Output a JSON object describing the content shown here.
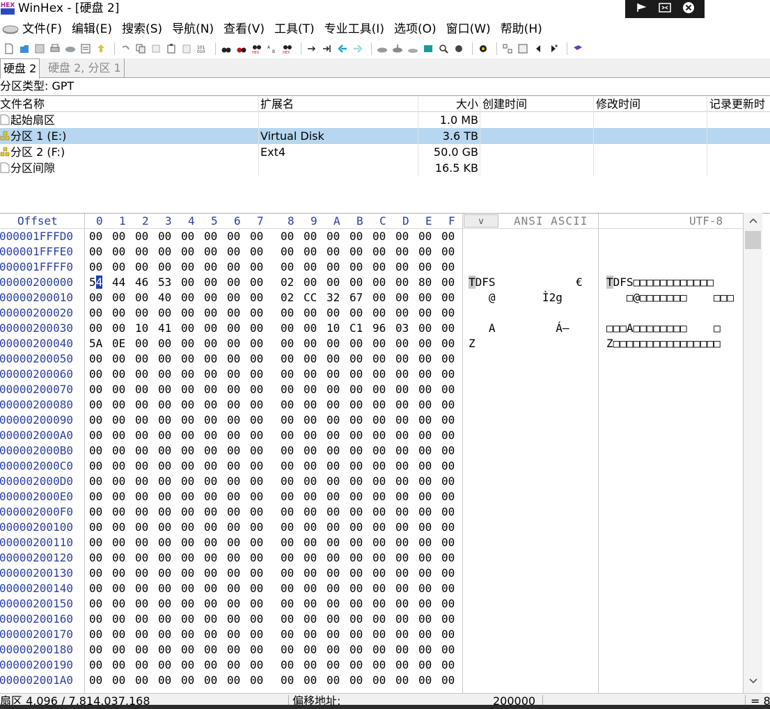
{
  "window": {
    "title": "WinHex - [硬盘 2]",
    "controls": [
      "flag-icon",
      "restore-icon",
      "close-icon"
    ]
  },
  "menu": {
    "items": [
      "文件(F)",
      "编辑(E)",
      "搜索(S)",
      "导航(N)",
      "查看(V)",
      "工具(T)",
      "专业工具(I)",
      "选项(O)",
      "窗口(W)",
      "帮助(H)"
    ]
  },
  "tabs": [
    "硬盘 2",
    "硬盘 2, 分区 1"
  ],
  "partition_type": "分区类型: GPT",
  "file_table": {
    "columns": [
      "文件名称",
      "扩展名",
      "大小",
      "创建时间",
      "修改时间",
      "记录更新时"
    ],
    "rows": [
      {
        "name": "起始扇区",
        "ext": "",
        "size": "1.0 MB",
        "icon": "file-icon",
        "selected": false
      },
      {
        "name": "分区 1 (E:)",
        "ext": "Virtual Disk",
        "size": "3.6 TB",
        "icon": "partition-icon",
        "selected": true
      },
      {
        "name": "分区 2 (F:)",
        "ext": "Ext4",
        "size": "50.0 GB",
        "icon": "partition-icon",
        "selected": false
      },
      {
        "name": "分区间隙",
        "ext": "",
        "size": "16.5 KB",
        "icon": "file-icon",
        "selected": false
      }
    ]
  },
  "hex": {
    "offset_header": "Offset",
    "column_headers": [
      "0",
      "1",
      "2",
      "3",
      "4",
      "5",
      "6",
      "7",
      "8",
      "9",
      "A",
      "B",
      "C",
      "D",
      "E",
      "F"
    ],
    "v_button": "v",
    "ansi_header": "ANSI ASCII",
    "utf8_header": "UTF-8",
    "rows": [
      {
        "offset": "000001FFFD0",
        "bytes": [
          "00",
          "00",
          "00",
          "00",
          "00",
          "00",
          "00",
          "00",
          "00",
          "00",
          "00",
          "00",
          "00",
          "00",
          "00",
          "00"
        ],
        "ansi": "",
        "utf8": ""
      },
      {
        "offset": "000001FFFE0",
        "bytes": [
          "00",
          "00",
          "00",
          "00",
          "00",
          "00",
          "00",
          "00",
          "00",
          "00",
          "00",
          "00",
          "00",
          "00",
          "00",
          "00"
        ],
        "ansi": "",
        "utf8": ""
      },
      {
        "offset": "000001FFFF0",
        "bytes": [
          "00",
          "00",
          "00",
          "00",
          "00",
          "00",
          "00",
          "00",
          "00",
          "00",
          "00",
          "00",
          "00",
          "00",
          "00",
          "00"
        ],
        "ansi": "",
        "utf8": ""
      },
      {
        "offset": "00000200000",
        "bytes": [
          "54",
          "44",
          "46",
          "53",
          "00",
          "00",
          "00",
          "00",
          "02",
          "00",
          "00",
          "00",
          "00",
          "00",
          "80",
          "00"
        ],
        "ansi": "TDFS            €",
        "utf8": "TDFS□□□□□□□□□□□□"
      },
      {
        "offset": "00000200010",
        "bytes": [
          "00",
          "00",
          "00",
          "40",
          "00",
          "00",
          "00",
          "00",
          "02",
          "CC",
          "32",
          "67",
          "00",
          "00",
          "00",
          "00"
        ],
        "ansi": "   @       Ì2g",
        "utf8": "   □@□□□□□□□    □□□"
      },
      {
        "offset": "00000200020",
        "bytes": [
          "00",
          "00",
          "00",
          "00",
          "00",
          "00",
          "00",
          "00",
          "00",
          "00",
          "00",
          "00",
          "00",
          "00",
          "00",
          "00"
        ],
        "ansi": "",
        "utf8": ""
      },
      {
        "offset": "00000200030",
        "bytes": [
          "00",
          "00",
          "10",
          "41",
          "00",
          "00",
          "00",
          "00",
          "00",
          "00",
          "10",
          "C1",
          "96",
          "03",
          "00",
          "00"
        ],
        "ansi": "   A         Á–",
        "utf8": "□□□A□□□□□□□□    □"
      },
      {
        "offset": "00000200040",
        "bytes": [
          "5A",
          "0E",
          "00",
          "00",
          "00",
          "00",
          "00",
          "00",
          "00",
          "00",
          "00",
          "00",
          "00",
          "00",
          "00",
          "00"
        ],
        "ansi": "Z",
        "utf8": "Z□□□□□□□□□□□□□□□□"
      },
      {
        "offset": "00000200050",
        "bytes": [
          "00",
          "00",
          "00",
          "00",
          "00",
          "00",
          "00",
          "00",
          "00",
          "00",
          "00",
          "00",
          "00",
          "00",
          "00",
          "00"
        ],
        "ansi": "",
        "utf8": ""
      },
      {
        "offset": "00000200060",
        "bytes": [
          "00",
          "00",
          "00",
          "00",
          "00",
          "00",
          "00",
          "00",
          "00",
          "00",
          "00",
          "00",
          "00",
          "00",
          "00",
          "00"
        ],
        "ansi": "",
        "utf8": ""
      },
      {
        "offset": "00000200070",
        "bytes": [
          "00",
          "00",
          "00",
          "00",
          "00",
          "00",
          "00",
          "00",
          "00",
          "00",
          "00",
          "00",
          "00",
          "00",
          "00",
          "00"
        ],
        "ansi": "",
        "utf8": ""
      },
      {
        "offset": "00000200080",
        "bytes": [
          "00",
          "00",
          "00",
          "00",
          "00",
          "00",
          "00",
          "00",
          "00",
          "00",
          "00",
          "00",
          "00",
          "00",
          "00",
          "00"
        ],
        "ansi": "",
        "utf8": ""
      },
      {
        "offset": "00000200090",
        "bytes": [
          "00",
          "00",
          "00",
          "00",
          "00",
          "00",
          "00",
          "00",
          "00",
          "00",
          "00",
          "00",
          "00",
          "00",
          "00",
          "00"
        ],
        "ansi": "",
        "utf8": ""
      },
      {
        "offset": "000002000A0",
        "bytes": [
          "00",
          "00",
          "00",
          "00",
          "00",
          "00",
          "00",
          "00",
          "00",
          "00",
          "00",
          "00",
          "00",
          "00",
          "00",
          "00"
        ],
        "ansi": "",
        "utf8": ""
      },
      {
        "offset": "000002000B0",
        "bytes": [
          "00",
          "00",
          "00",
          "00",
          "00",
          "00",
          "00",
          "00",
          "00",
          "00",
          "00",
          "00",
          "00",
          "00",
          "00",
          "00"
        ],
        "ansi": "",
        "utf8": ""
      },
      {
        "offset": "000002000C0",
        "bytes": [
          "00",
          "00",
          "00",
          "00",
          "00",
          "00",
          "00",
          "00",
          "00",
          "00",
          "00",
          "00",
          "00",
          "00",
          "00",
          "00"
        ],
        "ansi": "",
        "utf8": ""
      },
      {
        "offset": "000002000D0",
        "bytes": [
          "00",
          "00",
          "00",
          "00",
          "00",
          "00",
          "00",
          "00",
          "00",
          "00",
          "00",
          "00",
          "00",
          "00",
          "00",
          "00"
        ],
        "ansi": "",
        "utf8": ""
      },
      {
        "offset": "000002000E0",
        "bytes": [
          "00",
          "00",
          "00",
          "00",
          "00",
          "00",
          "00",
          "00",
          "00",
          "00",
          "00",
          "00",
          "00",
          "00",
          "00",
          "00"
        ],
        "ansi": "",
        "utf8": ""
      },
      {
        "offset": "000002000F0",
        "bytes": [
          "00",
          "00",
          "00",
          "00",
          "00",
          "00",
          "00",
          "00",
          "00",
          "00",
          "00",
          "00",
          "00",
          "00",
          "00",
          "00"
        ],
        "ansi": "",
        "utf8": ""
      },
      {
        "offset": "00000200100",
        "bytes": [
          "00",
          "00",
          "00",
          "00",
          "00",
          "00",
          "00",
          "00",
          "00",
          "00",
          "00",
          "00",
          "00",
          "00",
          "00",
          "00"
        ],
        "ansi": "",
        "utf8": ""
      },
      {
        "offset": "00000200110",
        "bytes": [
          "00",
          "00",
          "00",
          "00",
          "00",
          "00",
          "00",
          "00",
          "00",
          "00",
          "00",
          "00",
          "00",
          "00",
          "00",
          "00"
        ],
        "ansi": "",
        "utf8": ""
      },
      {
        "offset": "00000200120",
        "bytes": [
          "00",
          "00",
          "00",
          "00",
          "00",
          "00",
          "00",
          "00",
          "00",
          "00",
          "00",
          "00",
          "00",
          "00",
          "00",
          "00"
        ],
        "ansi": "",
        "utf8": ""
      },
      {
        "offset": "00000200130",
        "bytes": [
          "00",
          "00",
          "00",
          "00",
          "00",
          "00",
          "00",
          "00",
          "00",
          "00",
          "00",
          "00",
          "00",
          "00",
          "00",
          "00"
        ],
        "ansi": "",
        "utf8": ""
      },
      {
        "offset": "00000200140",
        "bytes": [
          "00",
          "00",
          "00",
          "00",
          "00",
          "00",
          "00",
          "00",
          "00",
          "00",
          "00",
          "00",
          "00",
          "00",
          "00",
          "00"
        ],
        "ansi": "",
        "utf8": ""
      },
      {
        "offset": "00000200150",
        "bytes": [
          "00",
          "00",
          "00",
          "00",
          "00",
          "00",
          "00",
          "00",
          "00",
          "00",
          "00",
          "00",
          "00",
          "00",
          "00",
          "00"
        ],
        "ansi": "",
        "utf8": ""
      },
      {
        "offset": "00000200160",
        "bytes": [
          "00",
          "00",
          "00",
          "00",
          "00",
          "00",
          "00",
          "00",
          "00",
          "00",
          "00",
          "00",
          "00",
          "00",
          "00",
          "00"
        ],
        "ansi": "",
        "utf8": ""
      },
      {
        "offset": "00000200170",
        "bytes": [
          "00",
          "00",
          "00",
          "00",
          "00",
          "00",
          "00",
          "00",
          "00",
          "00",
          "00",
          "00",
          "00",
          "00",
          "00",
          "00"
        ],
        "ansi": "",
        "utf8": ""
      },
      {
        "offset": "00000200180",
        "bytes": [
          "00",
          "00",
          "00",
          "00",
          "00",
          "00",
          "00",
          "00",
          "00",
          "00",
          "00",
          "00",
          "00",
          "00",
          "00",
          "00"
        ],
        "ansi": "",
        "utf8": ""
      },
      {
        "offset": "00000200190",
        "bytes": [
          "00",
          "00",
          "00",
          "00",
          "00",
          "00",
          "00",
          "00",
          "00",
          "00",
          "00",
          "00",
          "00",
          "00",
          "00",
          "00"
        ],
        "ansi": "",
        "utf8": ""
      },
      {
        "offset": "000002001A0",
        "bytes": [
          "00",
          "00",
          "00",
          "00",
          "00",
          "00",
          "00",
          "00",
          "00",
          "00",
          "00",
          "00",
          "00",
          "00",
          "00",
          "00"
        ],
        "ansi": "",
        "utf8": ""
      }
    ],
    "caret": {
      "row": 3,
      "byte": 0
    }
  },
  "status": {
    "sector": "扇区 4,096 / 7,814,037,168",
    "offset_label": "偏移地址:",
    "offset_value": "200000",
    "right": "= 8"
  },
  "colors": {
    "offset_blue": "#2a3fa6",
    "selection": "#b6d7ef",
    "caret": "#1f3fbf"
  }
}
